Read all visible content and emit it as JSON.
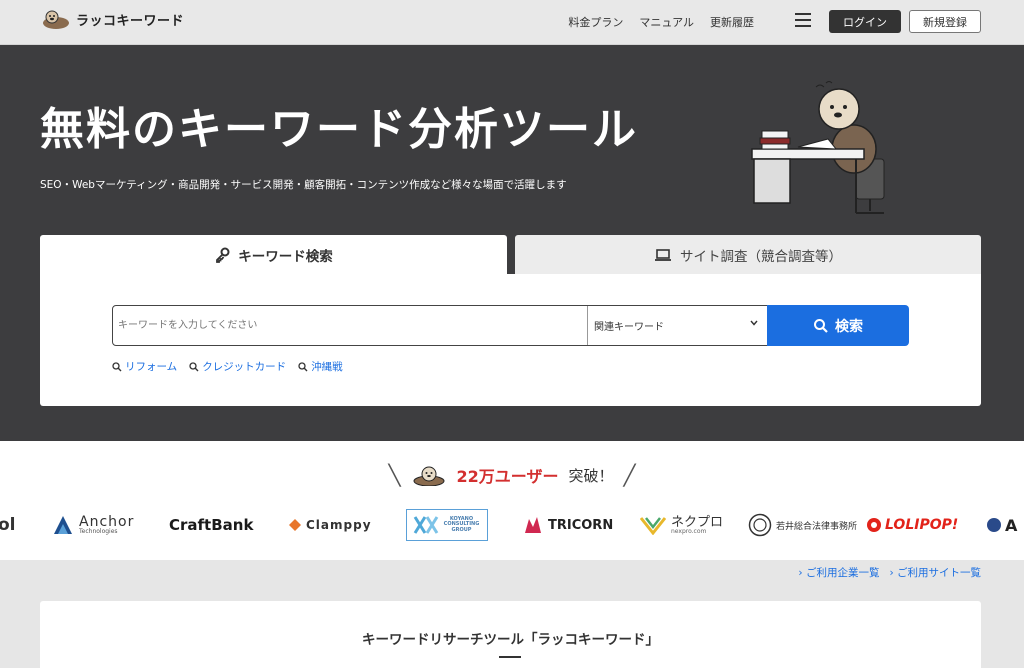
{
  "header": {
    "logo_text": "ラッコキーワード",
    "nav": [
      "料金プラン",
      "マニュアル",
      "更新履歴"
    ],
    "login": "ログイン",
    "signup": "新規登録"
  },
  "hero": {
    "title": "無料のキーワード分析ツール",
    "subtitle": "SEO・Webマーケティング・商品開発・サービス開発・顧客開拓・コンテンツ作成など様々な場面で活躍します"
  },
  "search": {
    "tabs": [
      "キーワード検索",
      "サイト調査（競合調査等）"
    ],
    "placeholder": "キーワードを入力してください",
    "select_value": "関連キーワード",
    "button": "検索",
    "suggestions": [
      "リフォーム",
      "クレジットカード",
      "沖縄戦"
    ]
  },
  "users": {
    "count": "22万ユーザー",
    "suffix": "突破！",
    "logos": [
      "ol",
      "Anchor",
      "Technologies",
      "CraftBank",
      "Clamppy",
      "KOYANO CONSULTING GROUP",
      "TRICORN",
      "ネクプロ",
      "nexpro.com",
      "若井総合法律事務所",
      "LOLIPOP!",
      "A"
    ]
  },
  "links": [
    "ご利用企業一覧",
    "ご利用サイト一覧"
  ],
  "lower": {
    "title": "キーワードリサーチツール「ラッコキーワード」"
  },
  "colors": {
    "hero_bg": "#3d3d3f",
    "accent_blue": "#1b6ee0",
    "count_red": "#d32f2f"
  }
}
